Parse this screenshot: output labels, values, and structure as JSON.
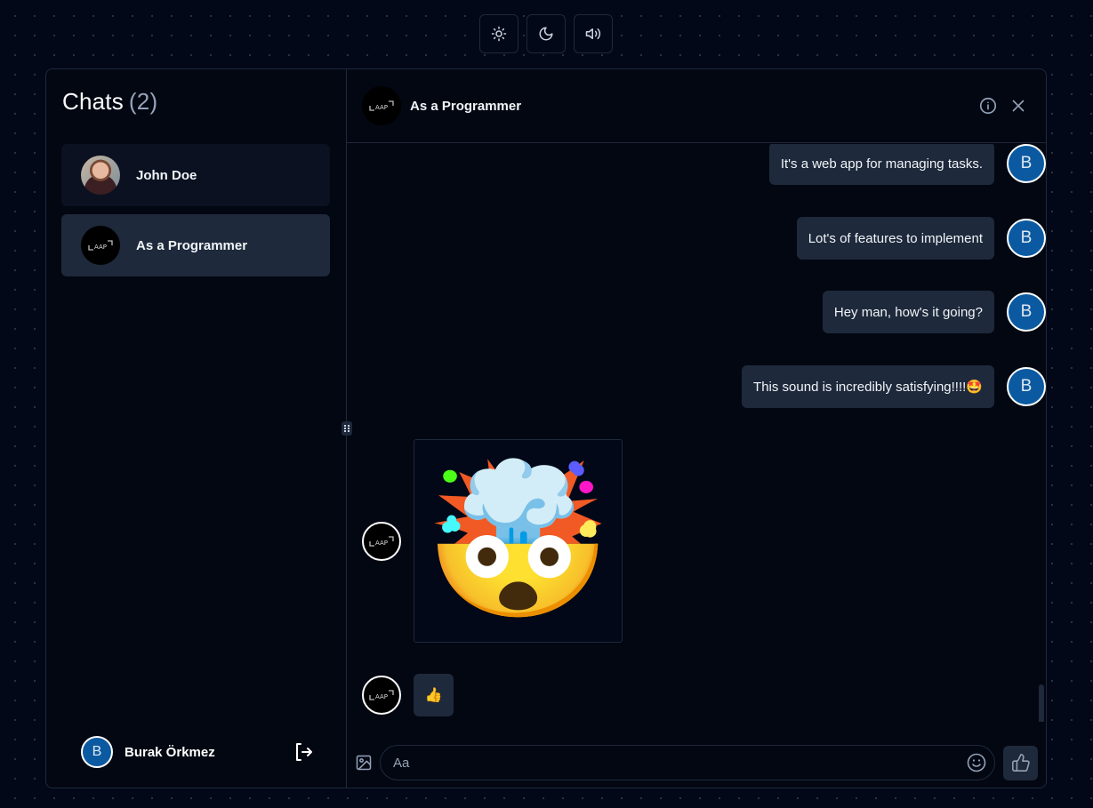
{
  "top_controls": {
    "light_theme": "sun-icon",
    "dark_theme": "moon-icon",
    "sound": "volume-icon"
  },
  "sidebar": {
    "title": "Chats",
    "count": "(2)",
    "chats": [
      {
        "name": "John Doe",
        "avatar": "profile-photo",
        "active": false
      },
      {
        "name": "As a Programmer",
        "avatar": "aap-logo",
        "active": true
      }
    ],
    "current_user": {
      "initial": "B",
      "name": "Burak Örkmez"
    },
    "logout_icon": "logout-icon"
  },
  "chat": {
    "header": {
      "title": "As a Programmer",
      "info_icon": "info-icon",
      "close_icon": "close-icon"
    },
    "messages": [
      {
        "from": "me",
        "text": "It's a web app for managing tasks.",
        "avatar_initial": "B"
      },
      {
        "from": "me",
        "text": "Lot's of features to implement",
        "avatar_initial": "B"
      },
      {
        "from": "me",
        "text": "Hey man, how's it going?",
        "avatar_initial": "B"
      },
      {
        "from": "me",
        "text": "This sound is incredibly satisfying!!!!🤩",
        "avatar_initial": "B"
      },
      {
        "from": "them",
        "type": "sticker",
        "content": "🤯"
      },
      {
        "from": "them",
        "type": "emoji",
        "content": "👍"
      }
    ],
    "composer": {
      "placeholder": "Aa",
      "value": "",
      "image_icon": "image-icon",
      "emoji_icon": "smile-icon",
      "send_icon": "thumbs-up-icon"
    }
  },
  "colors": {
    "background": "#020817",
    "panel": "#030712",
    "bubble": "#1e293b",
    "user_avatar": "#0b5aa1",
    "muted_text": "#94a3b8"
  }
}
